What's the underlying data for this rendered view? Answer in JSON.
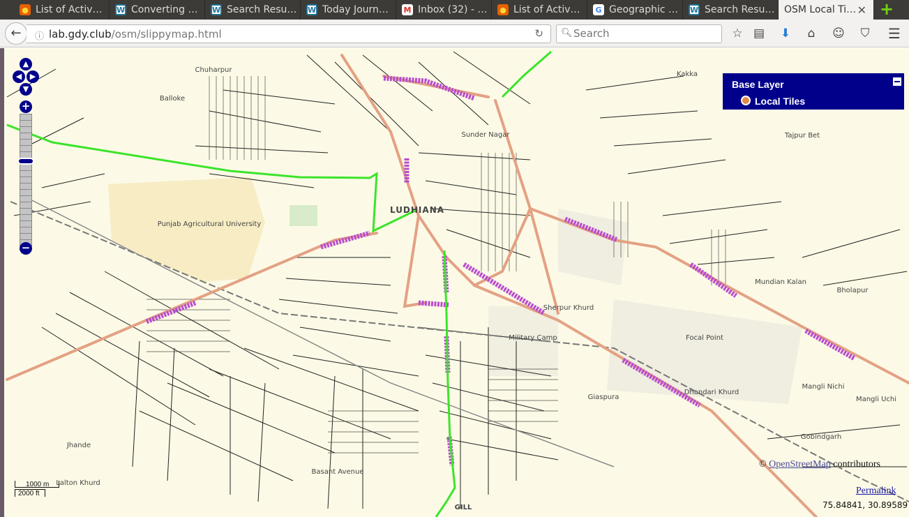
{
  "browser": {
    "tabs": [
      {
        "label": "List of Activ…",
        "icon": "firefox-icon"
      },
      {
        "label": "Converting …",
        "icon": "wordpress-icon"
      },
      {
        "label": "Search Resu…",
        "icon": "wordpress-icon"
      },
      {
        "label": "Today Journ…",
        "icon": "wordpress-icon"
      },
      {
        "label": "Inbox (32) - …",
        "icon": "gmail-icon"
      },
      {
        "label": "List of Activ…",
        "icon": "firefox-icon"
      },
      {
        "label": "Geographic …",
        "icon": "google-icon"
      },
      {
        "label": "Search Resu…",
        "icon": "wordpress-icon"
      },
      {
        "label": "OSM Local Ti…",
        "icon": "none",
        "active": true
      }
    ],
    "url": {
      "domain": "lab.gdy.club",
      "path": "/osm/slippymap.html"
    },
    "search_placeholder": "Search"
  },
  "map": {
    "layer_switcher": {
      "title": "Base Layer",
      "layer": "Local Tiles"
    },
    "attribution": {
      "prefix": "©",
      "link": "OpenStreetMap",
      "suffix": "contributors"
    },
    "permalink": "Permalink",
    "coordinates": "75.84841, 30.89589",
    "scale": {
      "metric": "1000 m",
      "imperial": "2000 ft"
    },
    "place_labels": {
      "ludhiana": "LUDHIANA",
      "pau": "Punjab Agricultural University",
      "military": "Military Camp",
      "focal": "Focal Point",
      "sherpur": "Sherpur Khurd",
      "dhandari": "Dhandari Khurd",
      "mangli_nichi": "Mangli Nichi",
      "mangli_uchi": "Mangli Uchi",
      "gobindgarh": "Gobindgarh",
      "bholapur": "Bholapur",
      "mundian": "Mundian Kalan",
      "kakka": "Kakka",
      "tajpur": "Tajpur Bet",
      "jhande": "Jhande",
      "lalton": "Lalton Khurd",
      "gill": "GILL",
      "basant": "Basant Avenue",
      "balloke": "Balloke",
      "giaspura": "Giaspura",
      "sunder": "Sunder Nagar",
      "chuharpur": "Chuharpur"
    },
    "colors": {
      "background": "#fcfae6",
      "trunk": "#e4a184",
      "highlight": "#b84dcf",
      "green_route": "#3be42a",
      "control": "#00008b"
    }
  }
}
